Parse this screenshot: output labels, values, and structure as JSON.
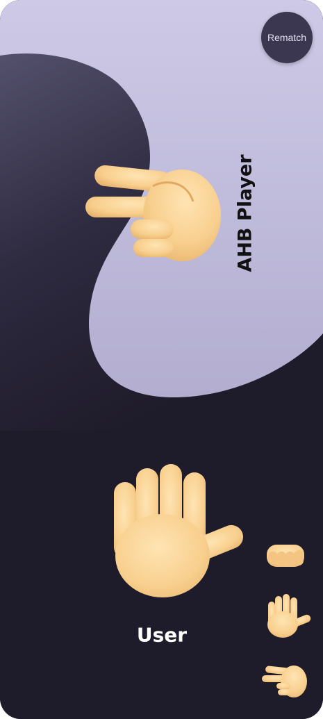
{
  "header": {
    "rematch_label": "Rematch"
  },
  "opponent": {
    "name": "AHB Player",
    "move": "scissors"
  },
  "user": {
    "name": "User",
    "move": "paper"
  },
  "choices": [
    {
      "move": "rock"
    },
    {
      "move": "paper"
    },
    {
      "move": "scissors"
    }
  ],
  "colors": {
    "background_dark": "#1e1b2a",
    "opponent_panel": "#c0bbdb",
    "button_bg": "#3b3750",
    "hand_skin": "#f8cf8e"
  }
}
